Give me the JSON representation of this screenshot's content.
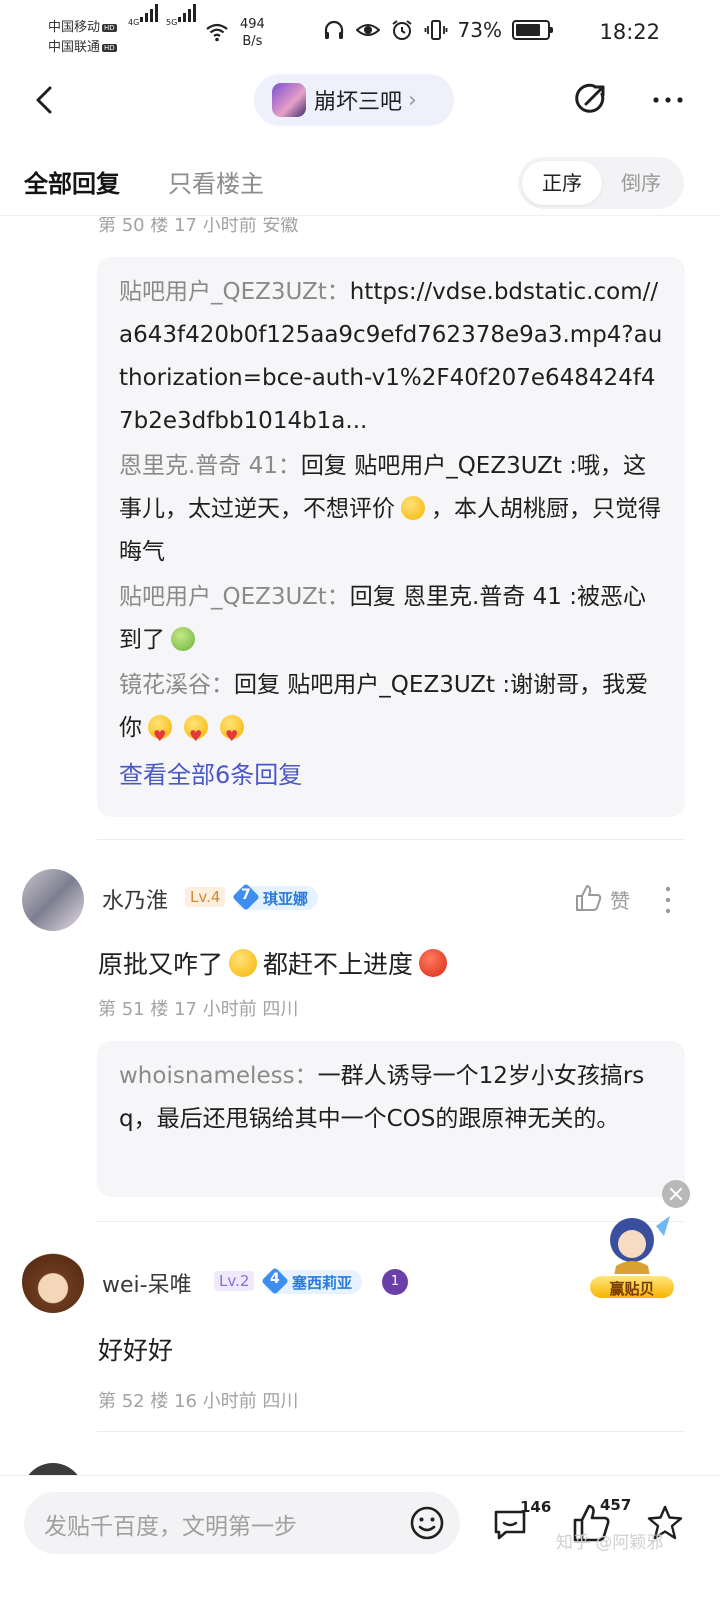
{
  "status_bar": {
    "carrier1": "中国移动",
    "carrier2": "中国联通",
    "hd": "HD",
    "net_4g": "4G",
    "net_5g": "5G",
    "speed_value": "494",
    "speed_unit": "B/s",
    "battery": "73%",
    "time": "18:22"
  },
  "nav": {
    "forum_name": "崩坏三吧",
    "chevron": "›"
  },
  "tabs": {
    "all_replies": "全部回复",
    "op_only": "只看楼主",
    "sort_asc": "正序",
    "sort_desc": "倒序"
  },
  "floor50": {
    "meta": "第 50 楼  17 小时前  安徽",
    "replies": [
      {
        "user": "贴吧用户_QEZ3UZt：",
        "text": "https://vdse.bdstatic.com//a643f420b0f125aa9c9efd762378e9a3.mp4?authorization=bce-auth-v1%2F40f207e648424f47b2e3dfbb1014b1a..."
      },
      {
        "user": "恩里克.普奇 41：",
        "text_before": "回复 贴吧用户_QEZ3UZt :哦，这事儿，太过逆天，不想评价",
        "text_after": "，本人胡桃厨，只觉得晦气"
      },
      {
        "user": "贴吧用户_QEZ3UZt：",
        "text": "回复 恩里克.普奇 41 :被恶心到了"
      },
      {
        "user": "镜花溪谷：",
        "text": "回复 贴吧用户_QEZ3UZt :谢谢哥，我爱你"
      }
    ],
    "see_all": "查看全部6条回复"
  },
  "floor51": {
    "username": "水乃淮",
    "level": "Lv.4",
    "title_level": "7",
    "title_name": "琪亚娜",
    "like_label": "赞",
    "content_before": "原批又咋了",
    "content_after": "都赶不上进度",
    "meta": "第 51 楼  17 小时前  四川",
    "reply_user": "whoisnameless：",
    "reply_text": "一群人诱导一个12岁小女孩搞rsq，最后还甩锅给其中一个COS的跟原神无关的。"
  },
  "floor52": {
    "username": "wei-呆唯",
    "level": "Lv.2",
    "title_level": "4",
    "title_name": "塞西莉亚",
    "medal_num": "1",
    "content": "好好好",
    "meta": "第 52 楼  16 小时前  四川"
  },
  "floating": {
    "label": "赢贴贝"
  },
  "bottom": {
    "input_placeholder": "发贴千百度，文明第一步",
    "comment_count": "146",
    "like_count": "457",
    "watermark": "知乎 @阿颖邪"
  },
  "colors": {
    "accent": "#4a57c6",
    "badge_blue": "#3d8ef0",
    "pill_bg": "#eef0fb"
  }
}
